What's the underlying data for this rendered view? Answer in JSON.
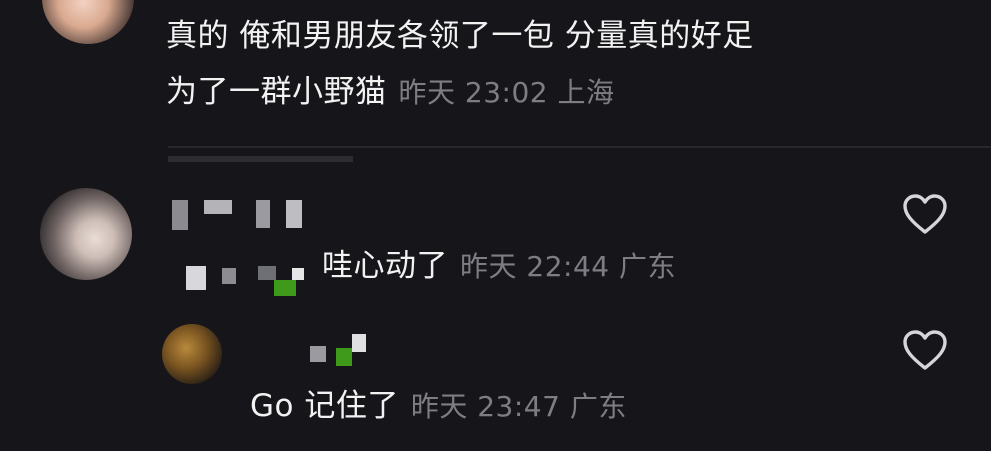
{
  "comment_top": {
    "line1": "真的 俺和男朋友各领了一包 分量真的好足",
    "line2": "为了一群小野猫",
    "time": "昨天 23:02",
    "location": "上海"
  },
  "reply_1": {
    "text": "哇心动了",
    "time": "昨天 22:44",
    "location": "广东",
    "like_icon": "heart-outline-icon"
  },
  "reply_2": {
    "text": "Go 记住了",
    "time": "昨天 23:47",
    "location": "广东",
    "like_icon": "heart-outline-icon"
  },
  "colors": {
    "background": "#16161a",
    "text": "#f2f2f2",
    "meta": "#7d7d84",
    "mosaic_green": "#3f9a1c"
  }
}
